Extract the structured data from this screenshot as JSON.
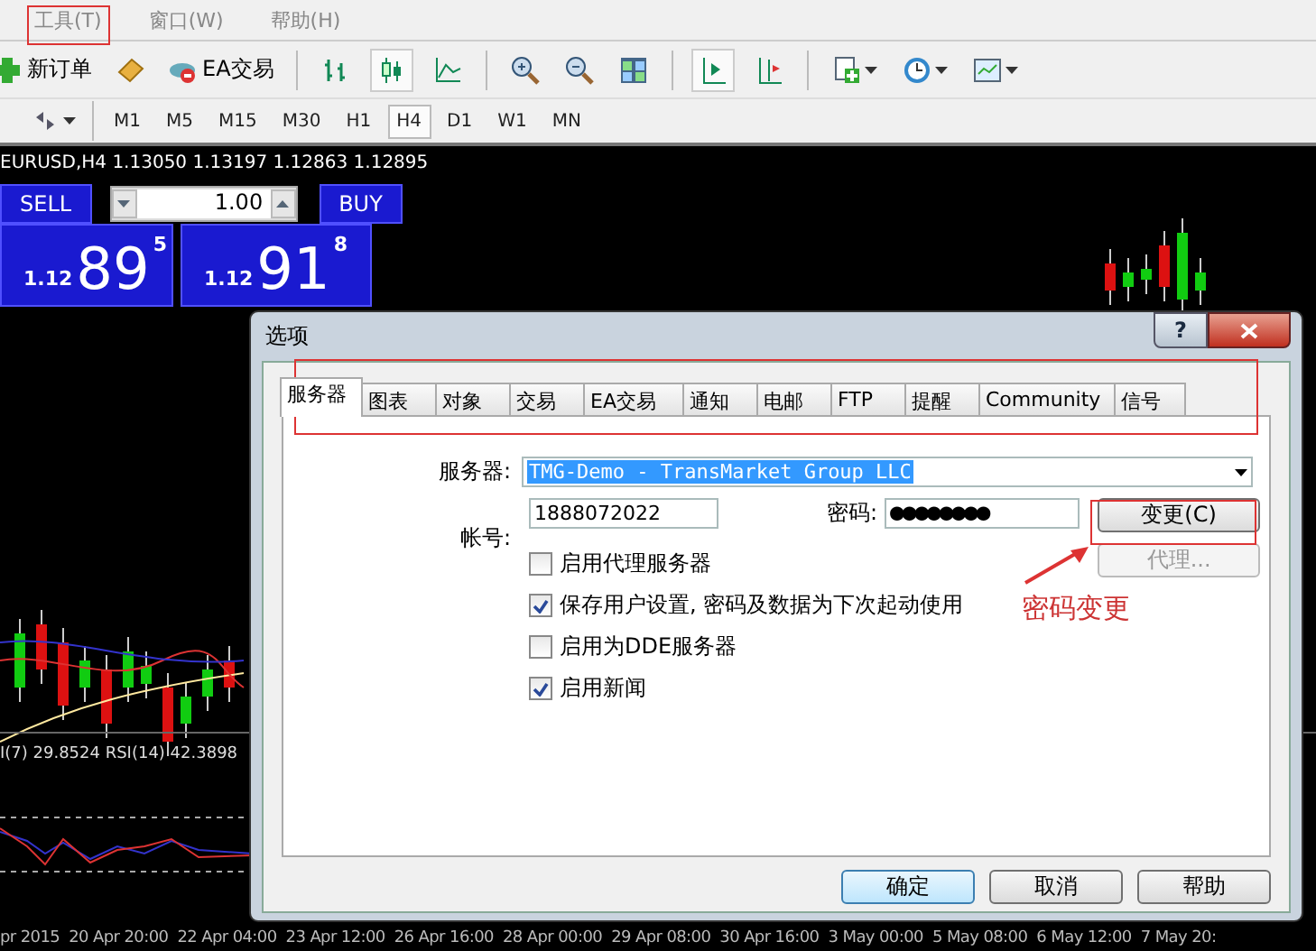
{
  "menu": [
    {
      "label": "工具(T)"
    },
    {
      "label": "窗口(W)"
    },
    {
      "label": "帮助(H)"
    }
  ],
  "toolbar": {
    "new_order": "新订单",
    "expert_trading": "EA交易"
  },
  "timeframes": [
    {
      "label": "M1",
      "selected": false
    },
    {
      "label": "M5",
      "selected": false
    },
    {
      "label": "M15",
      "selected": false
    },
    {
      "label": "M30",
      "selected": false
    },
    {
      "label": "H1",
      "selected": false
    },
    {
      "label": "H4",
      "selected": true
    },
    {
      "label": "D1",
      "selected": false
    },
    {
      "label": "W1",
      "selected": false
    },
    {
      "label": "MN",
      "selected": false
    }
  ],
  "chart": {
    "header": "EURUSD,H4  1.13050 1.13197 1.12863 1.12895",
    "trade_panel": {
      "sell": "SELL",
      "buy": "BUY",
      "volume": "1.00",
      "sell_price": {
        "prefix": "1.12",
        "big": "89",
        "small": "5"
      },
      "buy_price": {
        "prefix": "1.12",
        "big": "91",
        "small": "8"
      }
    },
    "indicator_label": "I(7) 29.8524  RSI(14) 42.3898",
    "time_axis": [
      "pr 2015",
      "20 Apr 20:00",
      "22 Apr 04:00",
      "23 Apr 12:00",
      "26 Apr 16:00",
      "28 Apr 00:00",
      "29 Apr 08:00",
      "30 Apr 16:00",
      "3 May 00:00",
      "5 May 08:00",
      "6 May 12:00",
      "7 May 20:"
    ]
  },
  "dialog": {
    "title": "选项",
    "help_glyph": "?",
    "tabs": [
      {
        "label": "服务器",
        "selected": true
      },
      {
        "label": "图表",
        "selected": false
      },
      {
        "label": "对象",
        "selected": false
      },
      {
        "label": "交易",
        "selected": false
      },
      {
        "label": "EA交易",
        "selected": false
      },
      {
        "label": "通知",
        "selected": false
      },
      {
        "label": "电邮",
        "selected": false
      },
      {
        "label": "FTP",
        "selected": false
      },
      {
        "label": "提醒",
        "selected": false
      },
      {
        "label": "Community",
        "selected": false
      },
      {
        "label": "信号",
        "selected": false
      }
    ],
    "server_label": "服务器:",
    "server": "TMG-Demo - TransMarket Group LLC",
    "login_label": "帐号:",
    "login": "1888072022",
    "password_label": "密码:",
    "password": "●●●●●●●●",
    "change_button": {
      "label": "变更(C)",
      "disabled": false
    },
    "proxy_button": {
      "label": "代理...",
      "disabled": true
    },
    "options": [
      {
        "label": "启用代理服务器",
        "checked": false
      },
      {
        "label": "保存用户设置, 密码及数据为下次起动使用",
        "checked": true
      },
      {
        "label": "启用为DDE服务器",
        "checked": false
      },
      {
        "label": "启用新闻",
        "checked": true
      }
    ],
    "buttons": [
      {
        "label": "确定",
        "default": true
      },
      {
        "label": "取消",
        "default": false
      },
      {
        "label": "帮助",
        "default": false
      }
    ]
  },
  "annotation": {
    "text": "密码变更"
  }
}
